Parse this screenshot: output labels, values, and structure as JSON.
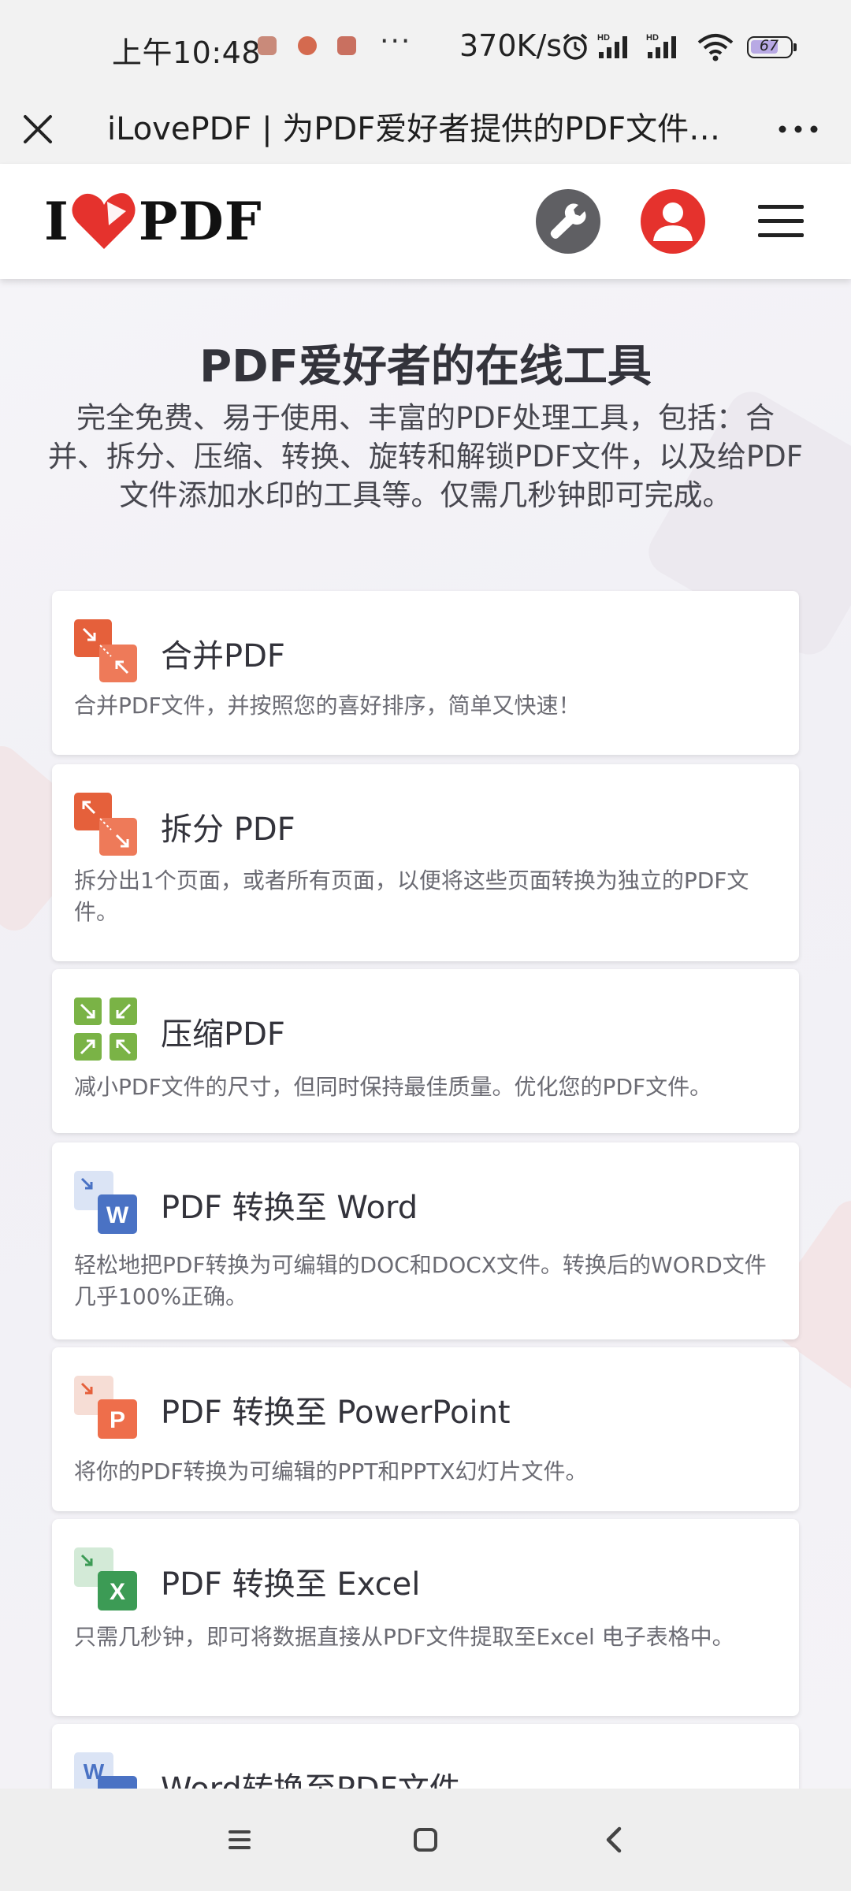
{
  "status_bar": {
    "time": "上午10:48",
    "dots": "···",
    "network_speed": "370K/s",
    "battery_level": "67"
  },
  "browser": {
    "page_title": "iLovePDF | 为PDF爱好者提供的PDF文件在线处理工具"
  },
  "site": {
    "logo_left": "I",
    "logo_right": "PDF",
    "brand_color": "#e5322d"
  },
  "hero": {
    "title": "PDF爱好者的在线工具",
    "description": "完全免费、易于使用、丰富的PDF处理工具，包括：合并、拆分、压缩、转换、旋转和解锁PDF文件，以及给PDF文件添加水印的工具等。仅需几秒钟即可完成。"
  },
  "tools": [
    {
      "title": "合并PDF",
      "description": "合并PDF文件，并按照您的喜好排序，简单又快速！",
      "icon": "merge-pdf-icon",
      "color": "#e5603b"
    },
    {
      "title": "拆分 PDF",
      "description": "拆分出1个页面，或者所有页面，以便将这些页面转换为独立的PDF文件。",
      "icon": "split-pdf-icon",
      "color": "#e5603b"
    },
    {
      "title": "压缩PDF",
      "description": "减小PDF文件的尺寸，但同时保持最佳质量。优化您的PDF文件。",
      "icon": "compress-pdf-icon",
      "color": "#7ab346"
    },
    {
      "title": "PDF 转换至 Word",
      "description": "轻松地把PDF转换为可编辑的DOC和DOCX文件。转换后的WORD文件几乎100%正确。",
      "icon": "pdf-to-word-icon",
      "color": "#4a72c4",
      "badge": "W"
    },
    {
      "title": "PDF 转换至 PowerPoint",
      "description": "将你的PDF转换为可编辑的PPT和PPTX幻灯片文件。",
      "icon": "pdf-to-powerpoint-icon",
      "color": "#e5603b",
      "badge": "P"
    },
    {
      "title": "PDF 转换至 Excel",
      "description": "只需几秒钟，即可将数据直接从PDF文件提取至Excel 电子表格中。",
      "icon": "pdf-to-excel-icon",
      "color": "#3c9b55",
      "badge": "X"
    },
    {
      "title": "Word转换至PDF文件",
      "icon": "word-to-pdf-icon",
      "color": "#4a72c4",
      "badge": "W"
    }
  ]
}
